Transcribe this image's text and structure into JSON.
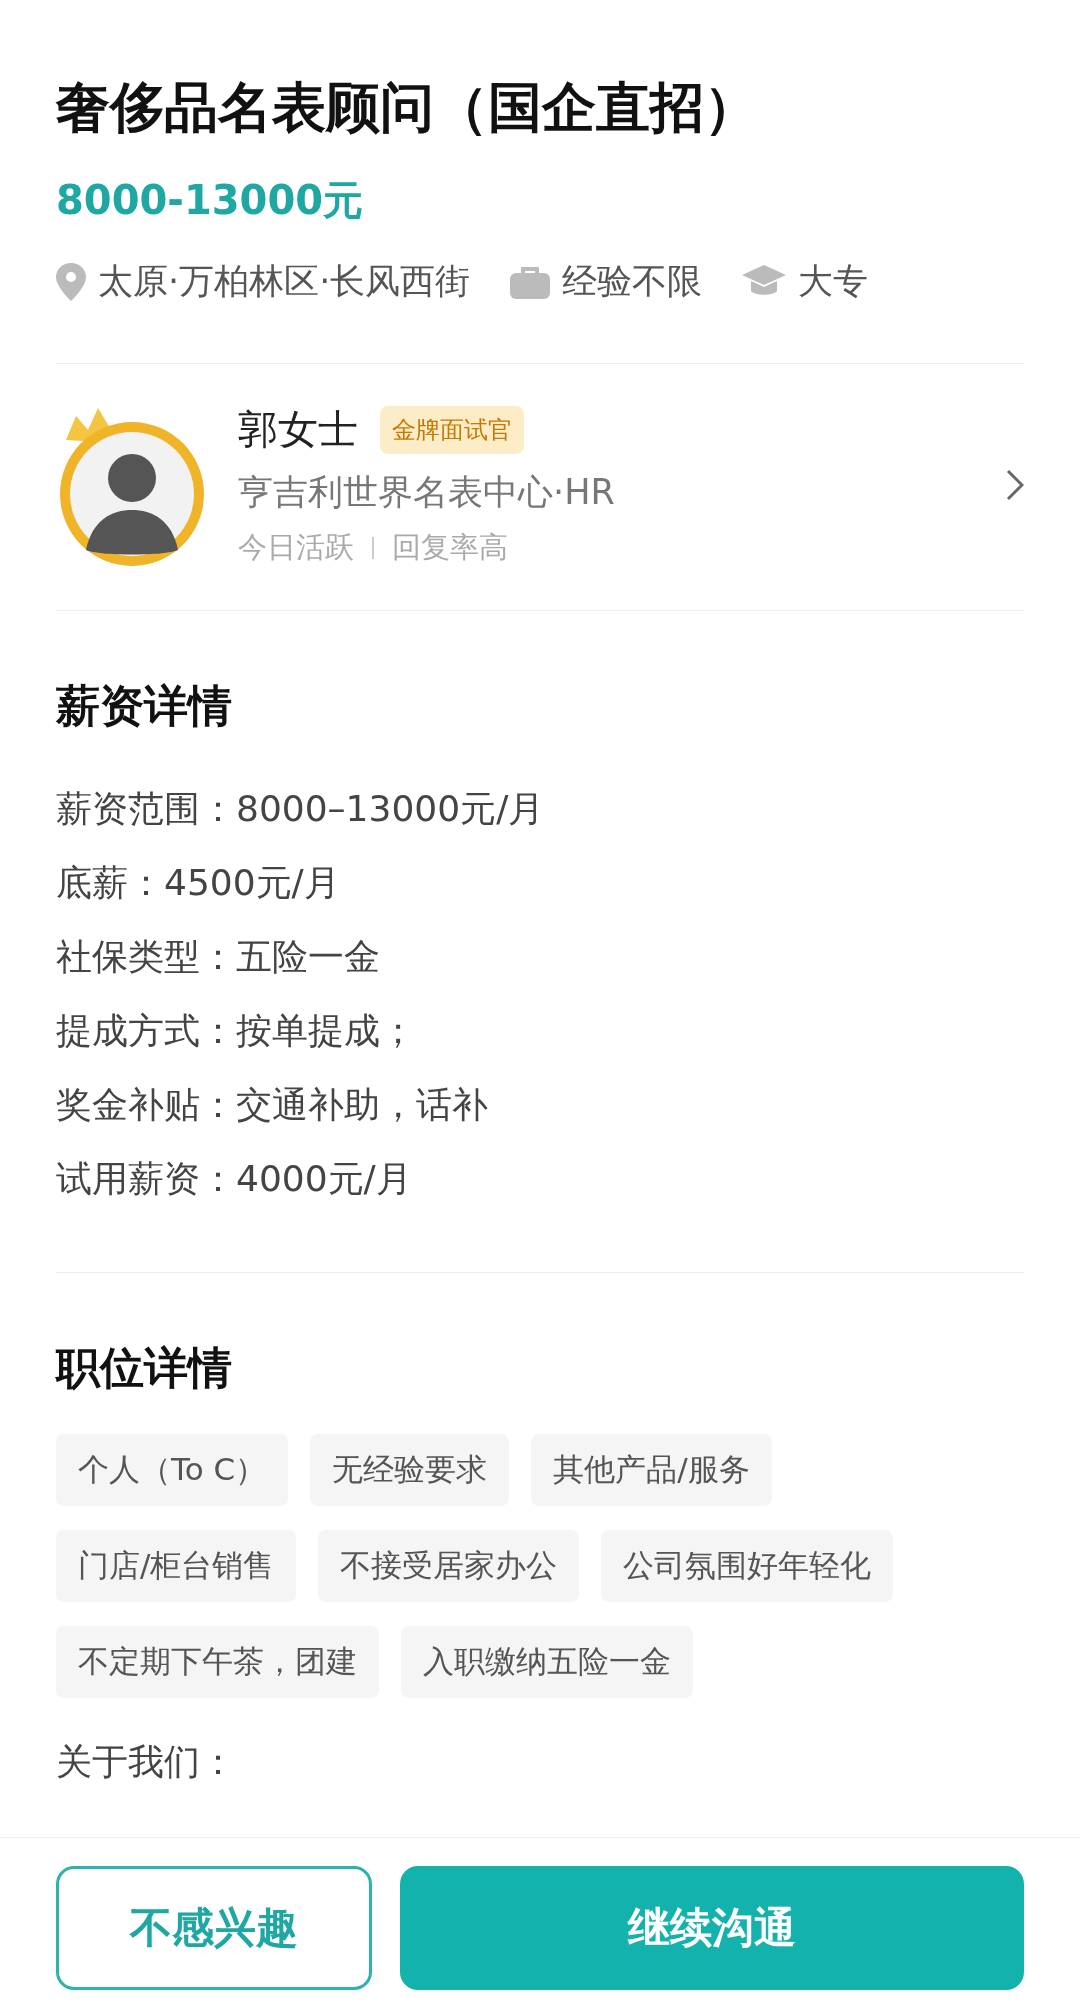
{
  "job": {
    "title": "奢侈品名表顾问（国企直招）",
    "salary": "8000-13000元",
    "meta": [
      {
        "kind": "location",
        "text": "太原·万柏林区·长风西街"
      },
      {
        "kind": "experience",
        "text": "经验不限"
      },
      {
        "kind": "education",
        "text": "大专"
      }
    ]
  },
  "recruiter": {
    "name": "郭女士",
    "badge": "金牌面试官",
    "company": "亨吉利世界名表中心·HR",
    "activity": [
      "今日活跃",
      "回复率高"
    ]
  },
  "salary_details": {
    "heading": "薪资详情",
    "lines": [
      "薪资范围：8000–13000元/月",
      "底薪：4500元/月",
      "社保类型：五险一金",
      "提成方式：按单提成；",
      "奖金补贴：交通补助，话补",
      "试用薪资：4000元/月"
    ]
  },
  "position_details": {
    "heading": "职位详情",
    "tags": [
      "个人（To C）",
      "无经验要求",
      "其他产品/服务",
      "门店/柜台销售",
      "不接受居家办公",
      "公司氛围好年轻化",
      "不定期下午茶，团建",
      "入职缴纳五险一金"
    ],
    "about": "关于我们："
  },
  "actions": [
    {
      "kind": "secondary",
      "label": "不感兴趣"
    },
    {
      "kind": "primary",
      "label": "继续沟通"
    }
  ]
}
